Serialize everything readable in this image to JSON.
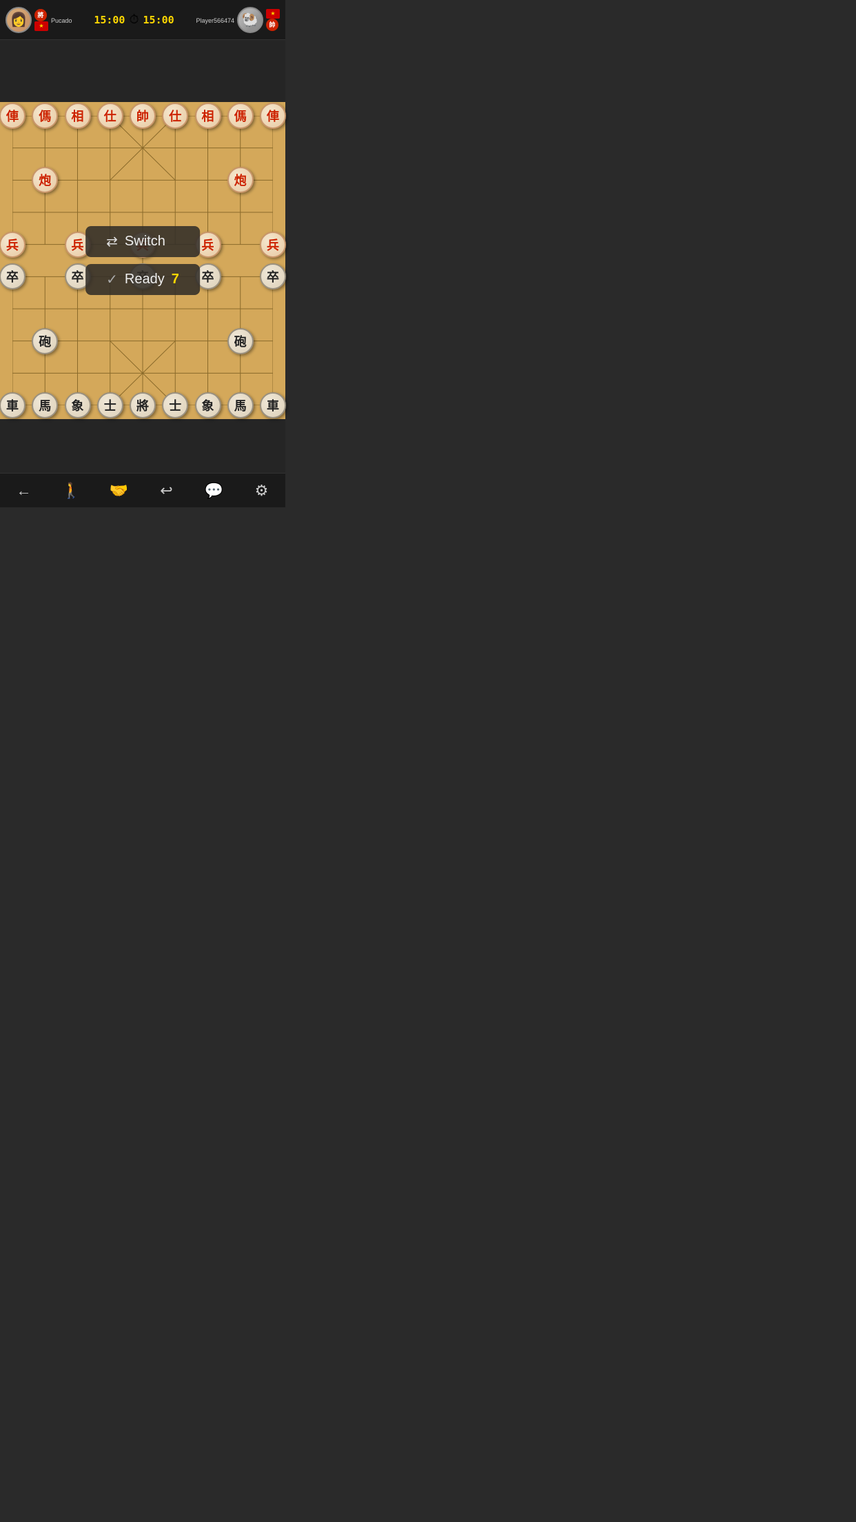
{
  "header": {
    "player_left": {
      "name": "Pucado",
      "rank": "將",
      "time": "15:00",
      "flag": "🇻🇳"
    },
    "player_right": {
      "name": "Player566474",
      "rank": "帥",
      "time": "15:00",
      "flag": "🇻🇳"
    },
    "clock_label": "⏱"
  },
  "board": {
    "red_pieces": [
      {
        "char": "俥",
        "col": 0,
        "row": 0
      },
      {
        "char": "傌",
        "col": 1,
        "row": 0
      },
      {
        "char": "相",
        "col": 2,
        "row": 0
      },
      {
        "char": "仕",
        "col": 3,
        "row": 0
      },
      {
        "char": "帥",
        "col": 4,
        "row": 0
      },
      {
        "char": "仕",
        "col": 5,
        "row": 0
      },
      {
        "char": "相",
        "col": 6,
        "row": 0
      },
      {
        "char": "傌",
        "col": 7,
        "row": 0
      },
      {
        "char": "俥",
        "col": 8,
        "row": 0
      },
      {
        "char": "炮",
        "col": 1,
        "row": 2
      },
      {
        "char": "炮",
        "col": 7,
        "row": 2
      },
      {
        "char": "兵",
        "col": 0,
        "row": 4
      },
      {
        "char": "兵",
        "col": 2,
        "row": 4
      },
      {
        "char": "兵",
        "col": 4,
        "row": 4
      },
      {
        "char": "兵",
        "col": 6,
        "row": 4
      },
      {
        "char": "兵",
        "col": 8,
        "row": 4
      }
    ],
    "black_pieces": [
      {
        "char": "車",
        "col": 0,
        "row": 9
      },
      {
        "char": "馬",
        "col": 1,
        "row": 9
      },
      {
        "char": "象",
        "col": 2,
        "row": 9
      },
      {
        "char": "士",
        "col": 3,
        "row": 9
      },
      {
        "char": "將",
        "col": 4,
        "row": 9
      },
      {
        "char": "士",
        "col": 5,
        "row": 9
      },
      {
        "char": "象",
        "col": 6,
        "row": 9
      },
      {
        "char": "馬",
        "col": 7,
        "row": 9
      },
      {
        "char": "車",
        "col": 8,
        "row": 9
      },
      {
        "char": "砲",
        "col": 1,
        "row": 7
      },
      {
        "char": "砲",
        "col": 7,
        "row": 7
      },
      {
        "char": "卒",
        "col": 0,
        "row": 5
      },
      {
        "char": "卒",
        "col": 2,
        "row": 5
      },
      {
        "char": "卒",
        "col": 4,
        "row": 5
      },
      {
        "char": "卒",
        "col": 6,
        "row": 5
      },
      {
        "char": "卒",
        "col": 8,
        "row": 5
      }
    ]
  },
  "buttons": {
    "switch_label": "Switch",
    "ready_label": "Ready",
    "ready_count": "7"
  },
  "toolbar": {
    "back": "←",
    "person": "🚶",
    "handshake": "🤝",
    "undo": "↩",
    "chat": "💬",
    "settings": "⚙"
  }
}
